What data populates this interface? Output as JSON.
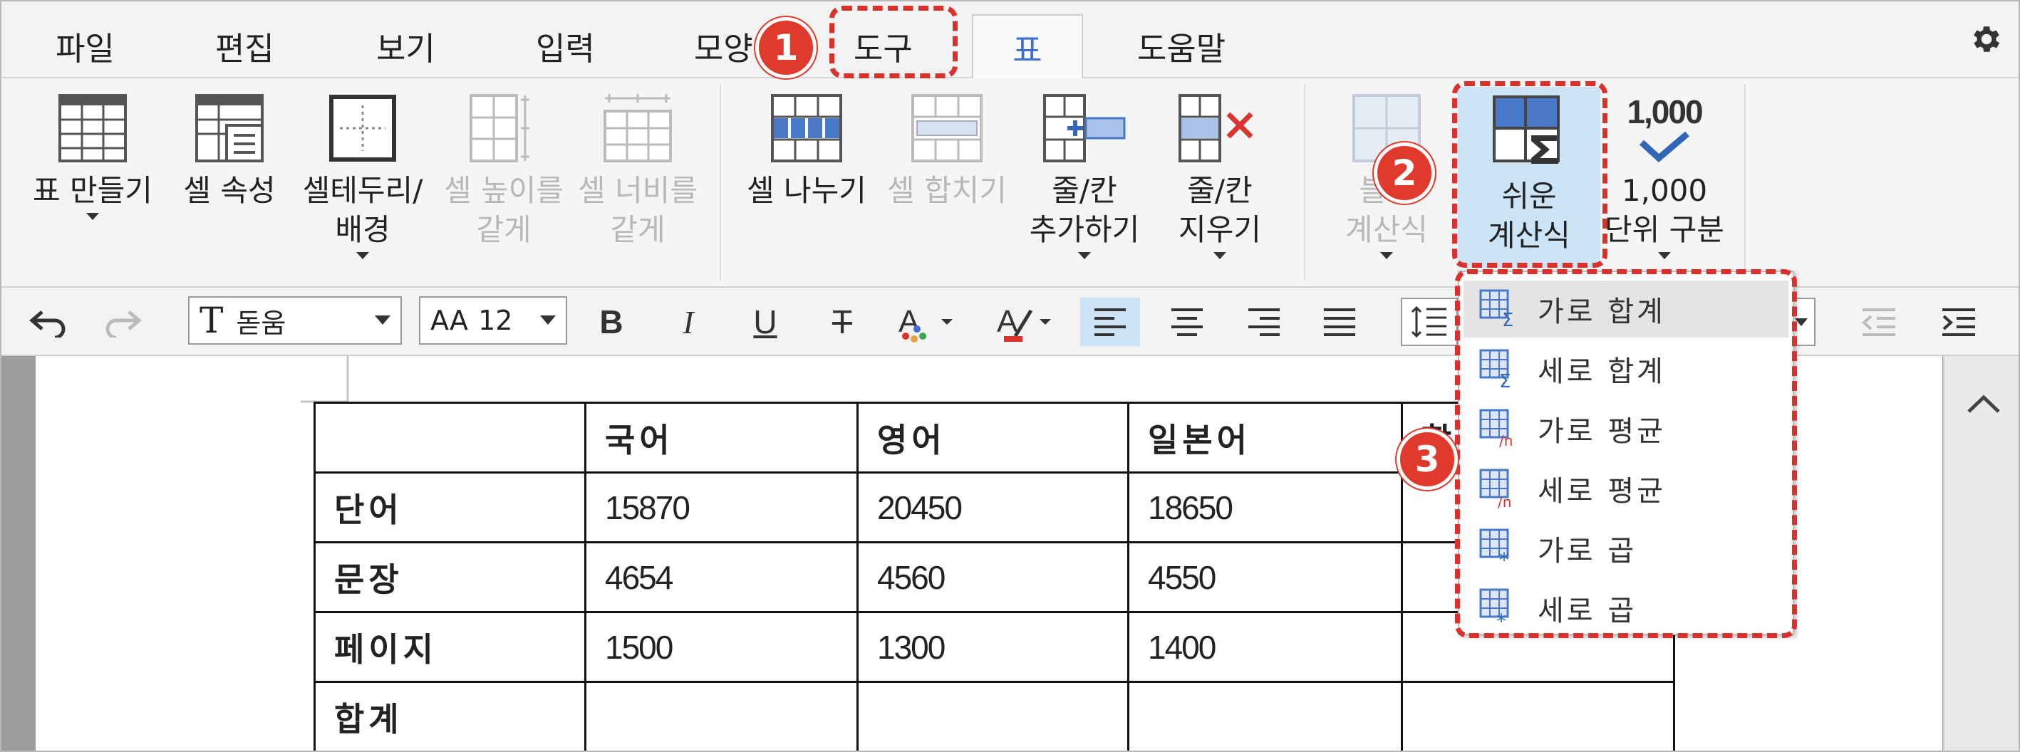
{
  "menu": {
    "tabs": [
      "파일",
      "편집",
      "보기",
      "입력",
      "모양",
      "도구",
      "표",
      "도움말"
    ],
    "active_tab": "표"
  },
  "ribbon": {
    "table_make": "표 만들기",
    "cell_props": "셀 속성",
    "cell_border_1": "셀테두리/",
    "cell_border_2": "배경",
    "eq_height_1": "셀 높이를",
    "eq_height_2": "같게",
    "eq_width_1": "셀 너비를",
    "eq_width_2": "같게",
    "split_cells": "셀 나누기",
    "merge_cells": "셀 합치기",
    "add_row_1": "줄/칸",
    "add_row_2": "추가하기",
    "del_row_1": "줄/칸",
    "del_row_2": "지우기",
    "block_calc_1": "블록",
    "block_calc_2": "계산식",
    "easy_calc_1": "쉬운",
    "easy_calc_2": "계산식",
    "thousand_icon": "1,000",
    "thousand_1": "1,000",
    "thousand_2": "단위 구분"
  },
  "format": {
    "font": "돋움",
    "size": "12",
    "bold": "B",
    "italic": "I",
    "underline": "U",
    "strike": "T"
  },
  "table": {
    "header": [
      "",
      "국어",
      "영어",
      "일본어",
      "합"
    ],
    "rows": [
      [
        "단어",
        "15870",
        "20450",
        "18650",
        ""
      ],
      [
        "문장",
        "4654",
        "4560",
        "4550",
        ""
      ],
      [
        "페이지",
        "1500",
        "1300",
        "1400",
        ""
      ],
      [
        "합계",
        "",
        "",
        "",
        ""
      ]
    ]
  },
  "dropdown": {
    "items": [
      "가로 합계",
      "세로 합계",
      "가로 평균",
      "세로 평균",
      "가로 곱",
      "세로 곱"
    ]
  },
  "badges": [
    "1",
    "2",
    "3"
  ],
  "colors": {
    "accent": "#3f6ed0",
    "annotation": "#d9312b",
    "selected_bg": "#cde4f7"
  }
}
